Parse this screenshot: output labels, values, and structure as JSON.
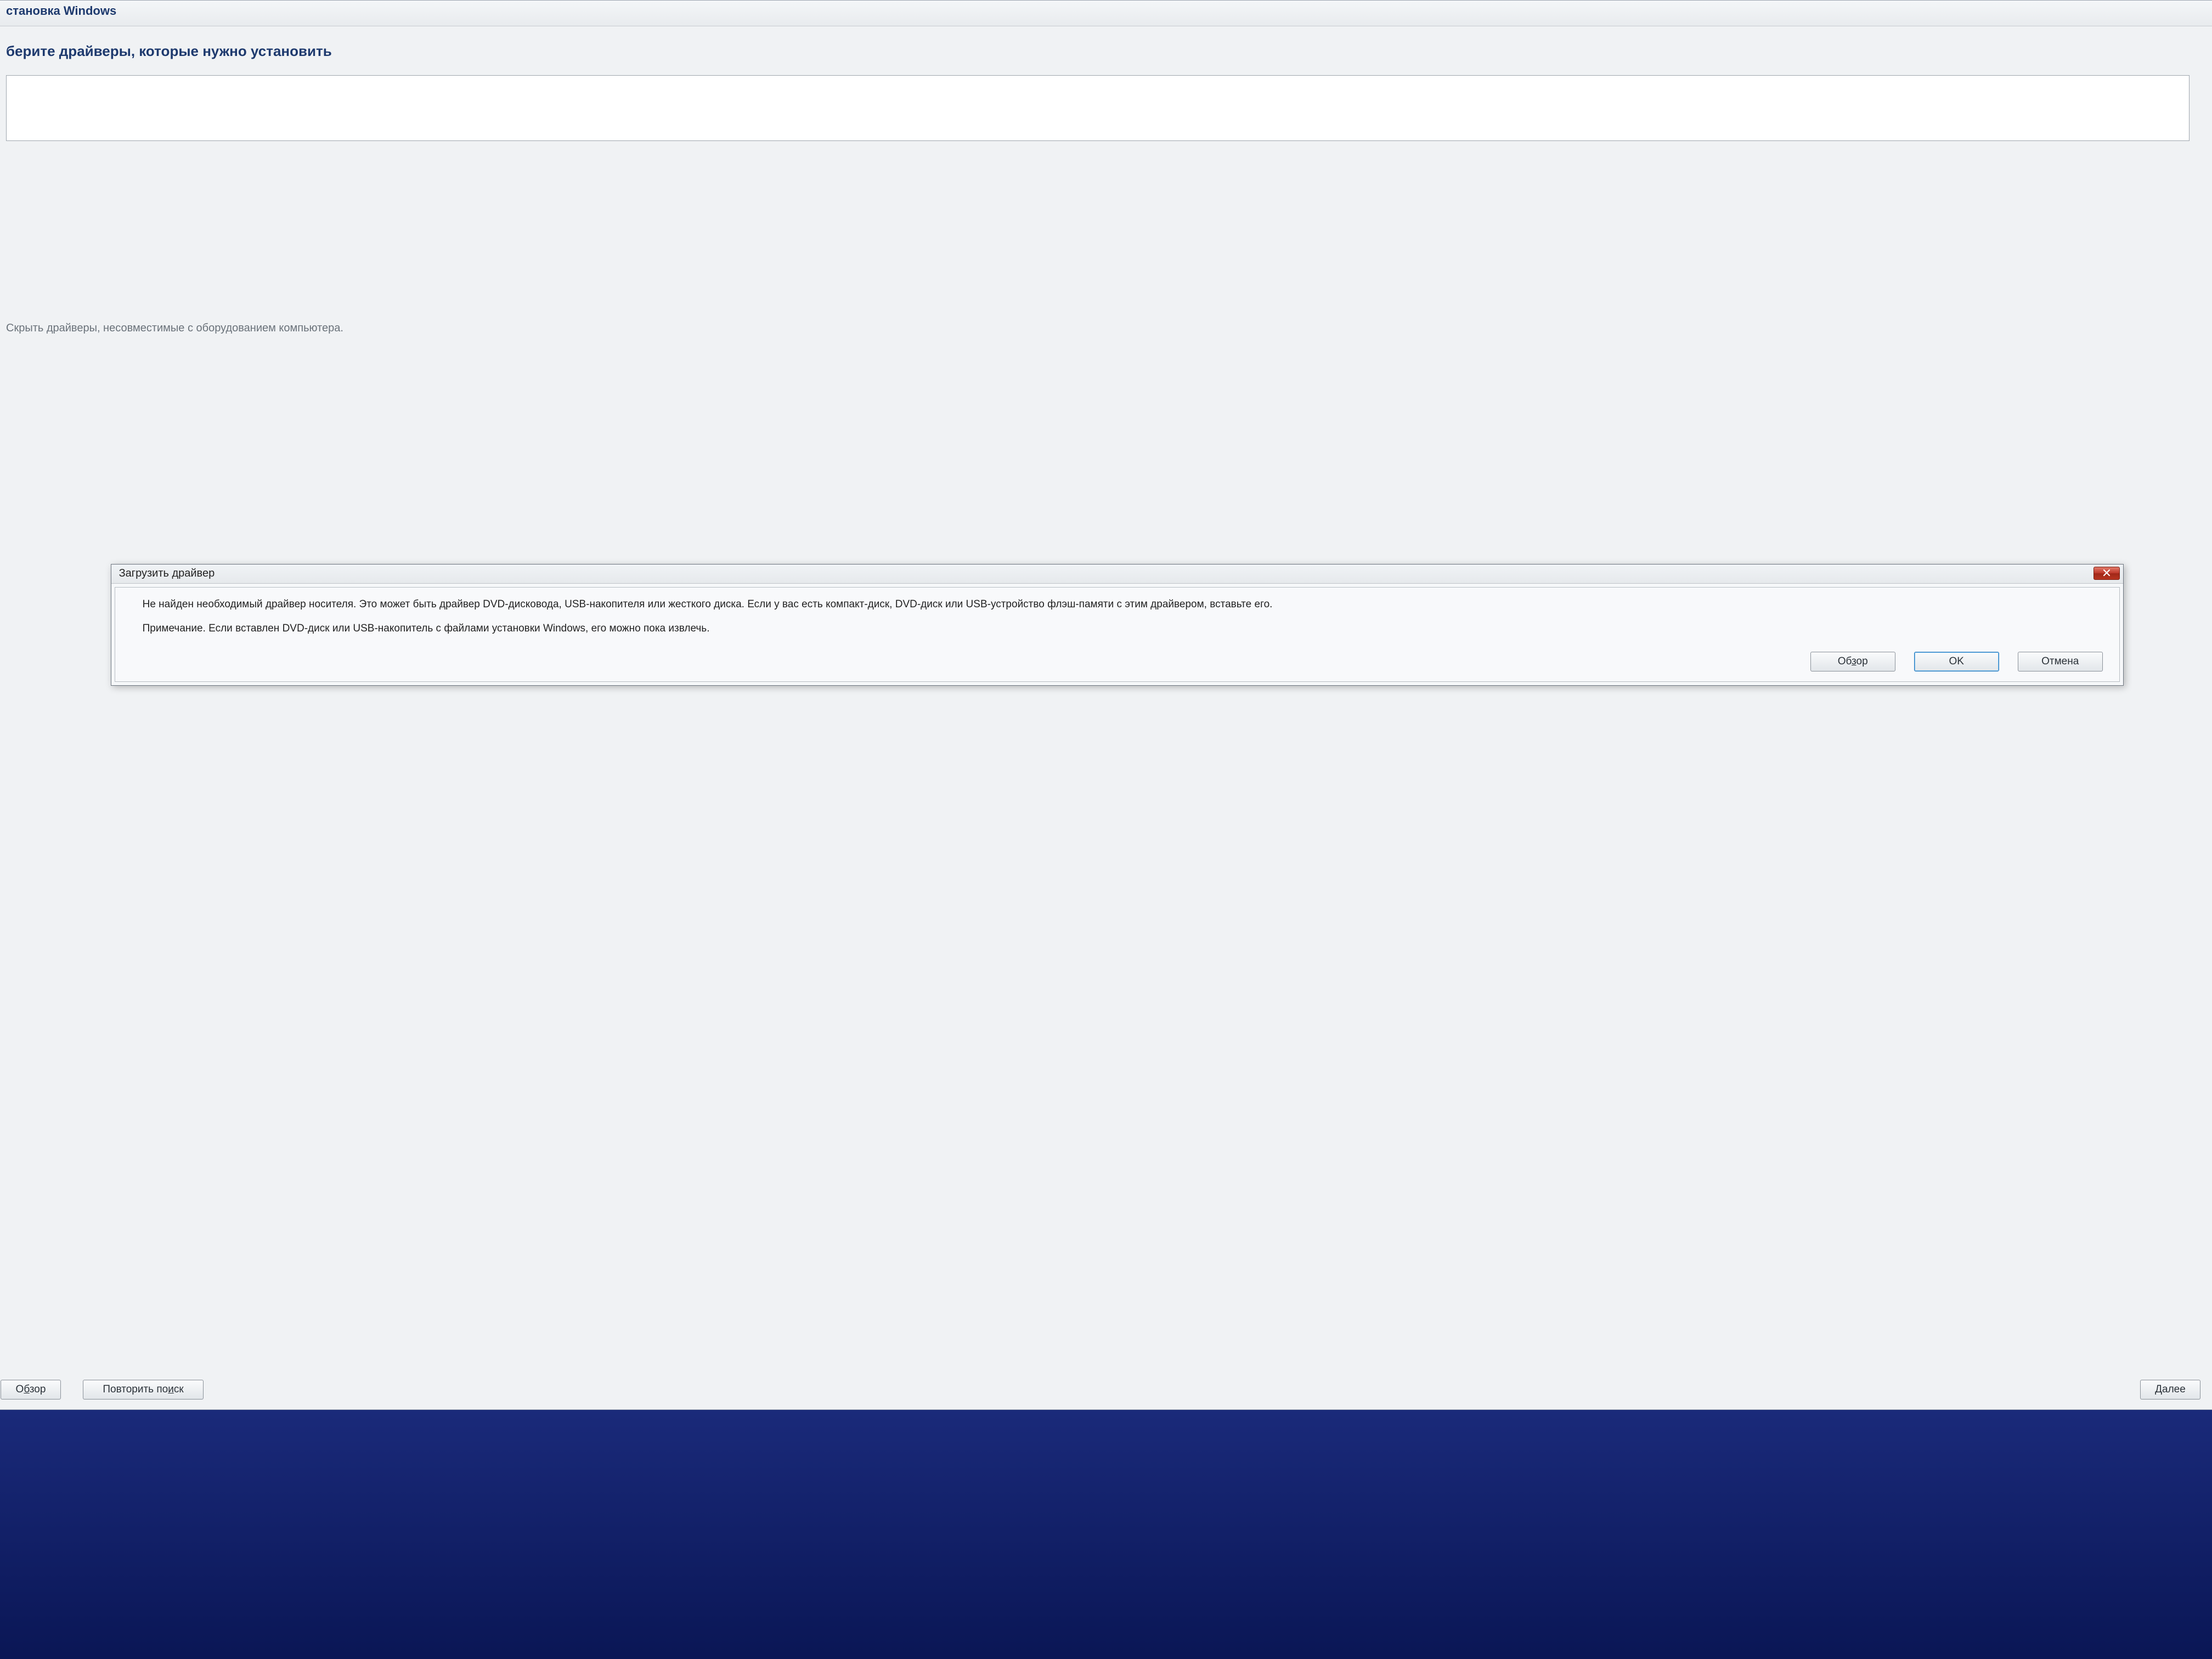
{
  "main_window": {
    "title": "становка Windows",
    "heading": "берите драйверы, которые нужно установить",
    "hide_incompatible_text": "Скрыть драйверы, несовместимые с оборудованием компьютера.",
    "buttons": {
      "browse": "Обзор",
      "rescan": "Повторить поиск",
      "next": "Далее"
    }
  },
  "modal": {
    "title": "Загрузить драйвер",
    "paragraph1": "Не найден необходимый драйвер носителя. Это может быть драйвер DVD-дисковода, USB-накопителя или жесткого диска. Если у вас есть компакт-диск, DVD-диск или USB-устройство флэш-памяти с этим драйвером, вставьте его.",
    "paragraph2": "Примечание. Если вставлен DVD-диск или USB-накопитель с файлами установки Windows, его можно пока извлечь.",
    "buttons": {
      "browse": "Обзор",
      "ok": "OK",
      "cancel": "Отмена"
    }
  }
}
